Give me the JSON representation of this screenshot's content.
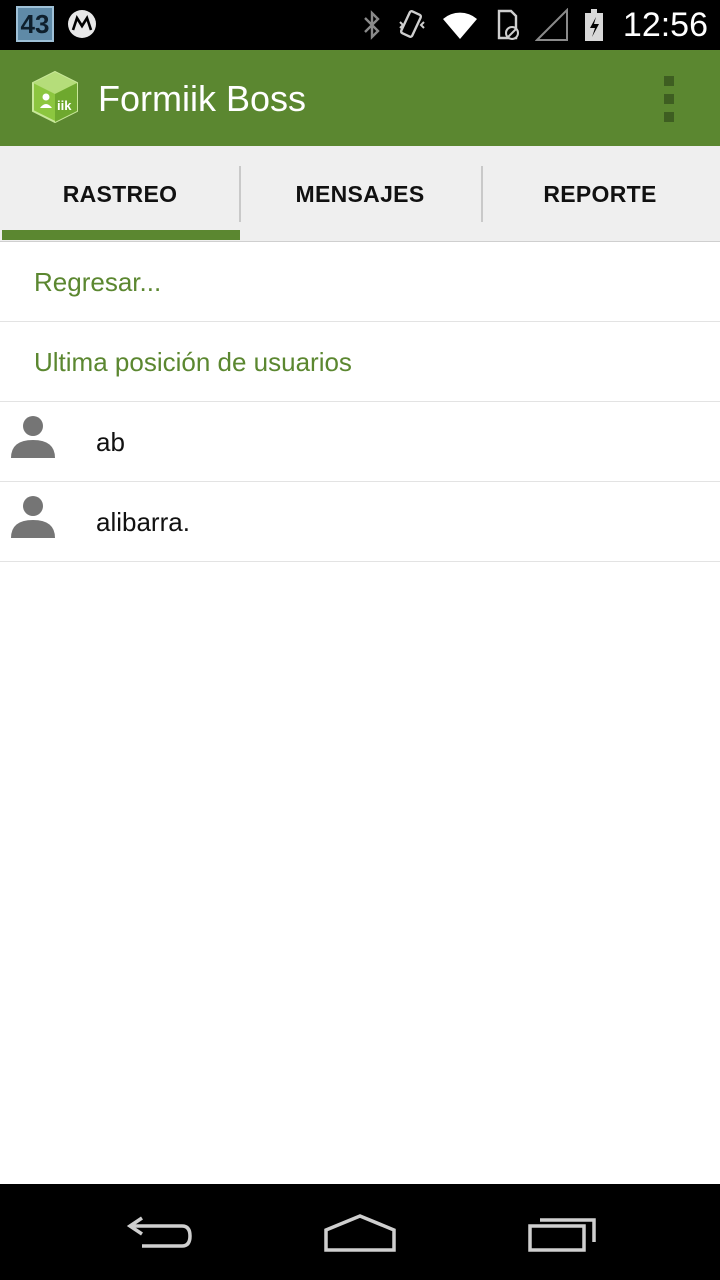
{
  "status_bar": {
    "notification_count": "43",
    "time": "12:56",
    "icons": [
      "motorola-icon",
      "bluetooth-icon",
      "vibrate-icon",
      "wifi-icon",
      "sd-card-icon",
      "signal-icon",
      "battery-icon"
    ]
  },
  "action_bar": {
    "title": "Formiik Boss",
    "logo_icon": "formiik-logo-icon",
    "accent_color": "#5b8730"
  },
  "tabs": [
    {
      "label": "RASTREO",
      "selected": true
    },
    {
      "label": "MENSAJES",
      "selected": false
    },
    {
      "label": "REPORTE",
      "selected": false
    }
  ],
  "list": {
    "back_link": "Regresar...",
    "section_title": "Ultima posición de usuarios",
    "users": [
      {
        "name": "ab",
        "icon": "person-icon"
      },
      {
        "name": "alibarra.",
        "icon": "person-icon"
      }
    ]
  },
  "nav_bar": {
    "icons": [
      "back-icon",
      "home-icon",
      "recents-icon"
    ]
  }
}
